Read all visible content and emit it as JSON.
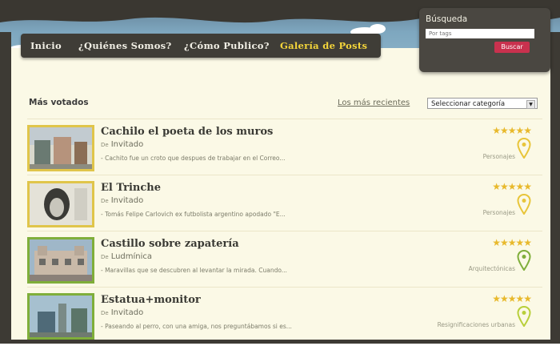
{
  "nav": {
    "items": [
      "Inicio",
      "¿Quiénes Somos?",
      "¿Cómo Publico?",
      "Galería de Posts"
    ],
    "active_index": 3
  },
  "search": {
    "title": "Búsqueda",
    "placeholder": "Por tags",
    "button": "Buscar"
  },
  "listing": {
    "title": "Más votados",
    "recent_link": "Los más recientes",
    "category_select": "Seleccionar categoría"
  },
  "posts": [
    {
      "title": "Cachilo el poeta de los muros",
      "by": "De",
      "author": "Invitado",
      "excerpt": "- Cachito fue un croto que despues de trabajar en el Correo...",
      "category": "Personajes",
      "rating": 5,
      "pin_color": "#e8c53a"
    },
    {
      "title": "El Trinche",
      "by": "De",
      "author": "Invitado",
      "excerpt": "- Tomás Felipe Carlovich ex futbolista argentino apodado \"E...",
      "category": "Personajes",
      "rating": 5,
      "pin_color": "#e8c53a"
    },
    {
      "title": "Castillo sobre zapatería",
      "by": "De",
      "author": "Ludmínica",
      "excerpt": "- Maravillas que se descubren al levantar la mirada. Cuando...",
      "category": "Arquitectónicas",
      "rating": 5,
      "pin_color": "#7fae3a"
    },
    {
      "title": "Estatua+monitor",
      "by": "De",
      "author": "Invitado",
      "excerpt": "- Paseando al perro, con una amiga, nos preguntábamos si es...",
      "category": "Resignificaciones urbanas",
      "rating": 5,
      "pin_color": "#b8cf3a"
    }
  ],
  "colors": {
    "accent_nav": "#f4d53a",
    "search_button": "#c9314e",
    "background": "#fbf9e6",
    "stars": "#e8b92c"
  }
}
